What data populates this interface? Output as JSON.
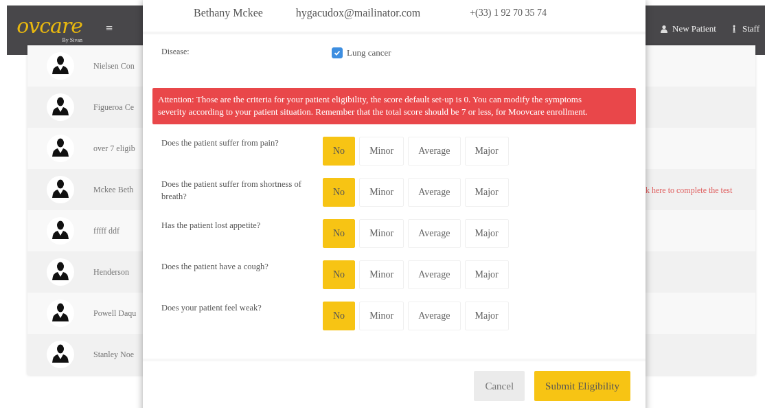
{
  "app": {
    "logo": "ovcare",
    "logo_sub": "By Sivan",
    "menu_glyph": "≡",
    "nav": [
      {
        "label": "New Patient"
      },
      {
        "label": "Staff"
      }
    ]
  },
  "patients": [
    {
      "name": "Nielsen Con"
    },
    {
      "name": "Figueroa Ce"
    },
    {
      "name": "over 7 eligib"
    },
    {
      "name": "Mckee Beth",
      "action": "k here to complete the test"
    },
    {
      "name": "fffff ddf"
    },
    {
      "name": "Henderson"
    },
    {
      "name": "Powell Daqu"
    },
    {
      "name": "Stanley Noe"
    }
  ],
  "modal": {
    "patient": {
      "name": "Bethany Mckee",
      "email": "hygacudox@mailinator.com",
      "phone": "+(33) 1 92 70 35 74"
    },
    "disease_label": "Disease:",
    "diseases": [
      {
        "label": "Lung cancer",
        "checked": true
      }
    ],
    "alert": "Attention: Those are the criteria for your patient eligibility, the score default set-up is 0. You can modify the symptoms severity according to your patient situation. Remember that the total score should be 7 or less, for Moovcare enrollment.",
    "questions": [
      {
        "text": "Does the patient suffer from pain?",
        "options": [
          {
            "label": "No",
            "selected": true
          },
          {
            "label": "Minor",
            "selected": false
          },
          {
            "label": "Average",
            "selected": false
          },
          {
            "label": "Major",
            "selected": false
          }
        ]
      },
      {
        "text": "Does the patient suffer from shortness of breath?",
        "options": [
          {
            "label": "No",
            "selected": true
          },
          {
            "label": "Minor",
            "selected": false
          },
          {
            "label": "Average",
            "selected": false
          },
          {
            "label": "Major",
            "selected": false
          }
        ]
      },
      {
        "text": "Has the patient lost appetite?",
        "options": [
          {
            "label": "No",
            "selected": true
          },
          {
            "label": "Minor",
            "selected": false
          },
          {
            "label": "Average",
            "selected": false
          },
          {
            "label": "Major",
            "selected": false
          }
        ]
      },
      {
        "text": "Does the patient have a cough?",
        "options": [
          {
            "label": "No",
            "selected": true
          },
          {
            "label": "Minor",
            "selected": false
          },
          {
            "label": "Average",
            "selected": false
          },
          {
            "label": "Major",
            "selected": false
          }
        ]
      },
      {
        "text": "Does your patient feel weak?",
        "options": [
          {
            "label": "No",
            "selected": true
          },
          {
            "label": "Minor",
            "selected": false
          },
          {
            "label": "Average",
            "selected": false
          },
          {
            "label": "Major",
            "selected": false
          }
        ]
      }
    ],
    "buttons": [
      {
        "label": "Cancel",
        "kind": "secondary"
      },
      {
        "label": "Submit Eligibility",
        "kind": "primary"
      }
    ]
  }
}
